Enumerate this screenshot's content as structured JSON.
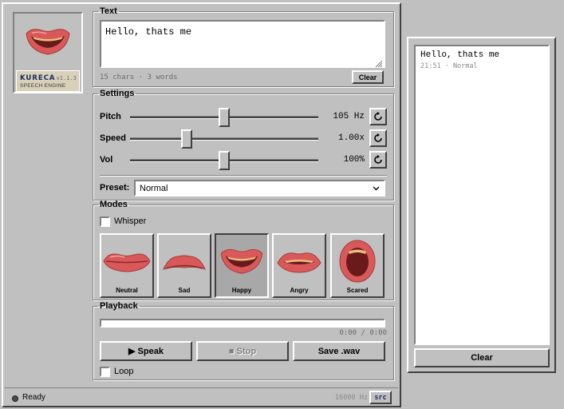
{
  "badge": {
    "name": "KURECA",
    "version": "v1.1.3",
    "tagline": "SPEECH ENGINE"
  },
  "text": {
    "legend": "Text",
    "value": "Hello, thats me",
    "stats": "15 chars · 3 words",
    "clear_label": "Clear"
  },
  "settings": {
    "legend": "Settings",
    "pitch": {
      "label": "Pitch",
      "value": "105 Hz",
      "level": 0.5
    },
    "speed": {
      "label": "Speed",
      "value": "1.00x",
      "level": 0.3
    },
    "vol": {
      "label": "Vol",
      "value": "100%",
      "level": 0.5
    },
    "preset_label": "Preset:",
    "preset_value": "Normal"
  },
  "modes": {
    "legend": "Modes",
    "whisper_label": "Whisper",
    "whisper_checked": false,
    "items": [
      {
        "label": "Neutral",
        "icon": "neutral-mouth-icon",
        "active": false
      },
      {
        "label": "Sad",
        "icon": "sad-mouth-icon",
        "active": false
      },
      {
        "label": "Happy",
        "icon": "happy-mouth-icon",
        "active": true
      },
      {
        "label": "Angry",
        "icon": "angry-mouth-icon",
        "active": false
      },
      {
        "label": "Scared",
        "icon": "scared-mouth-icon",
        "active": false
      }
    ]
  },
  "playback": {
    "legend": "Playback",
    "progress": 0,
    "time": "0:00 / 0:00",
    "speak_label": "▶ Speak",
    "stop_label": "■ Stop",
    "save_label": "Save .wav",
    "loop_label": "Loop",
    "loop_checked": false
  },
  "status": {
    "text": "Ready",
    "sample_rate": "16000 Hz",
    "src_label": "src"
  },
  "log": {
    "entry_text": "Hello, thats me",
    "entry_meta": "21:51 · Normal",
    "clear_label": "Clear"
  },
  "colors": {
    "lip": "#d9595a",
    "lip_dark": "#a83838",
    "teeth": "#c79a4a",
    "window": "#c0c0c0",
    "progress": "#000080"
  }
}
